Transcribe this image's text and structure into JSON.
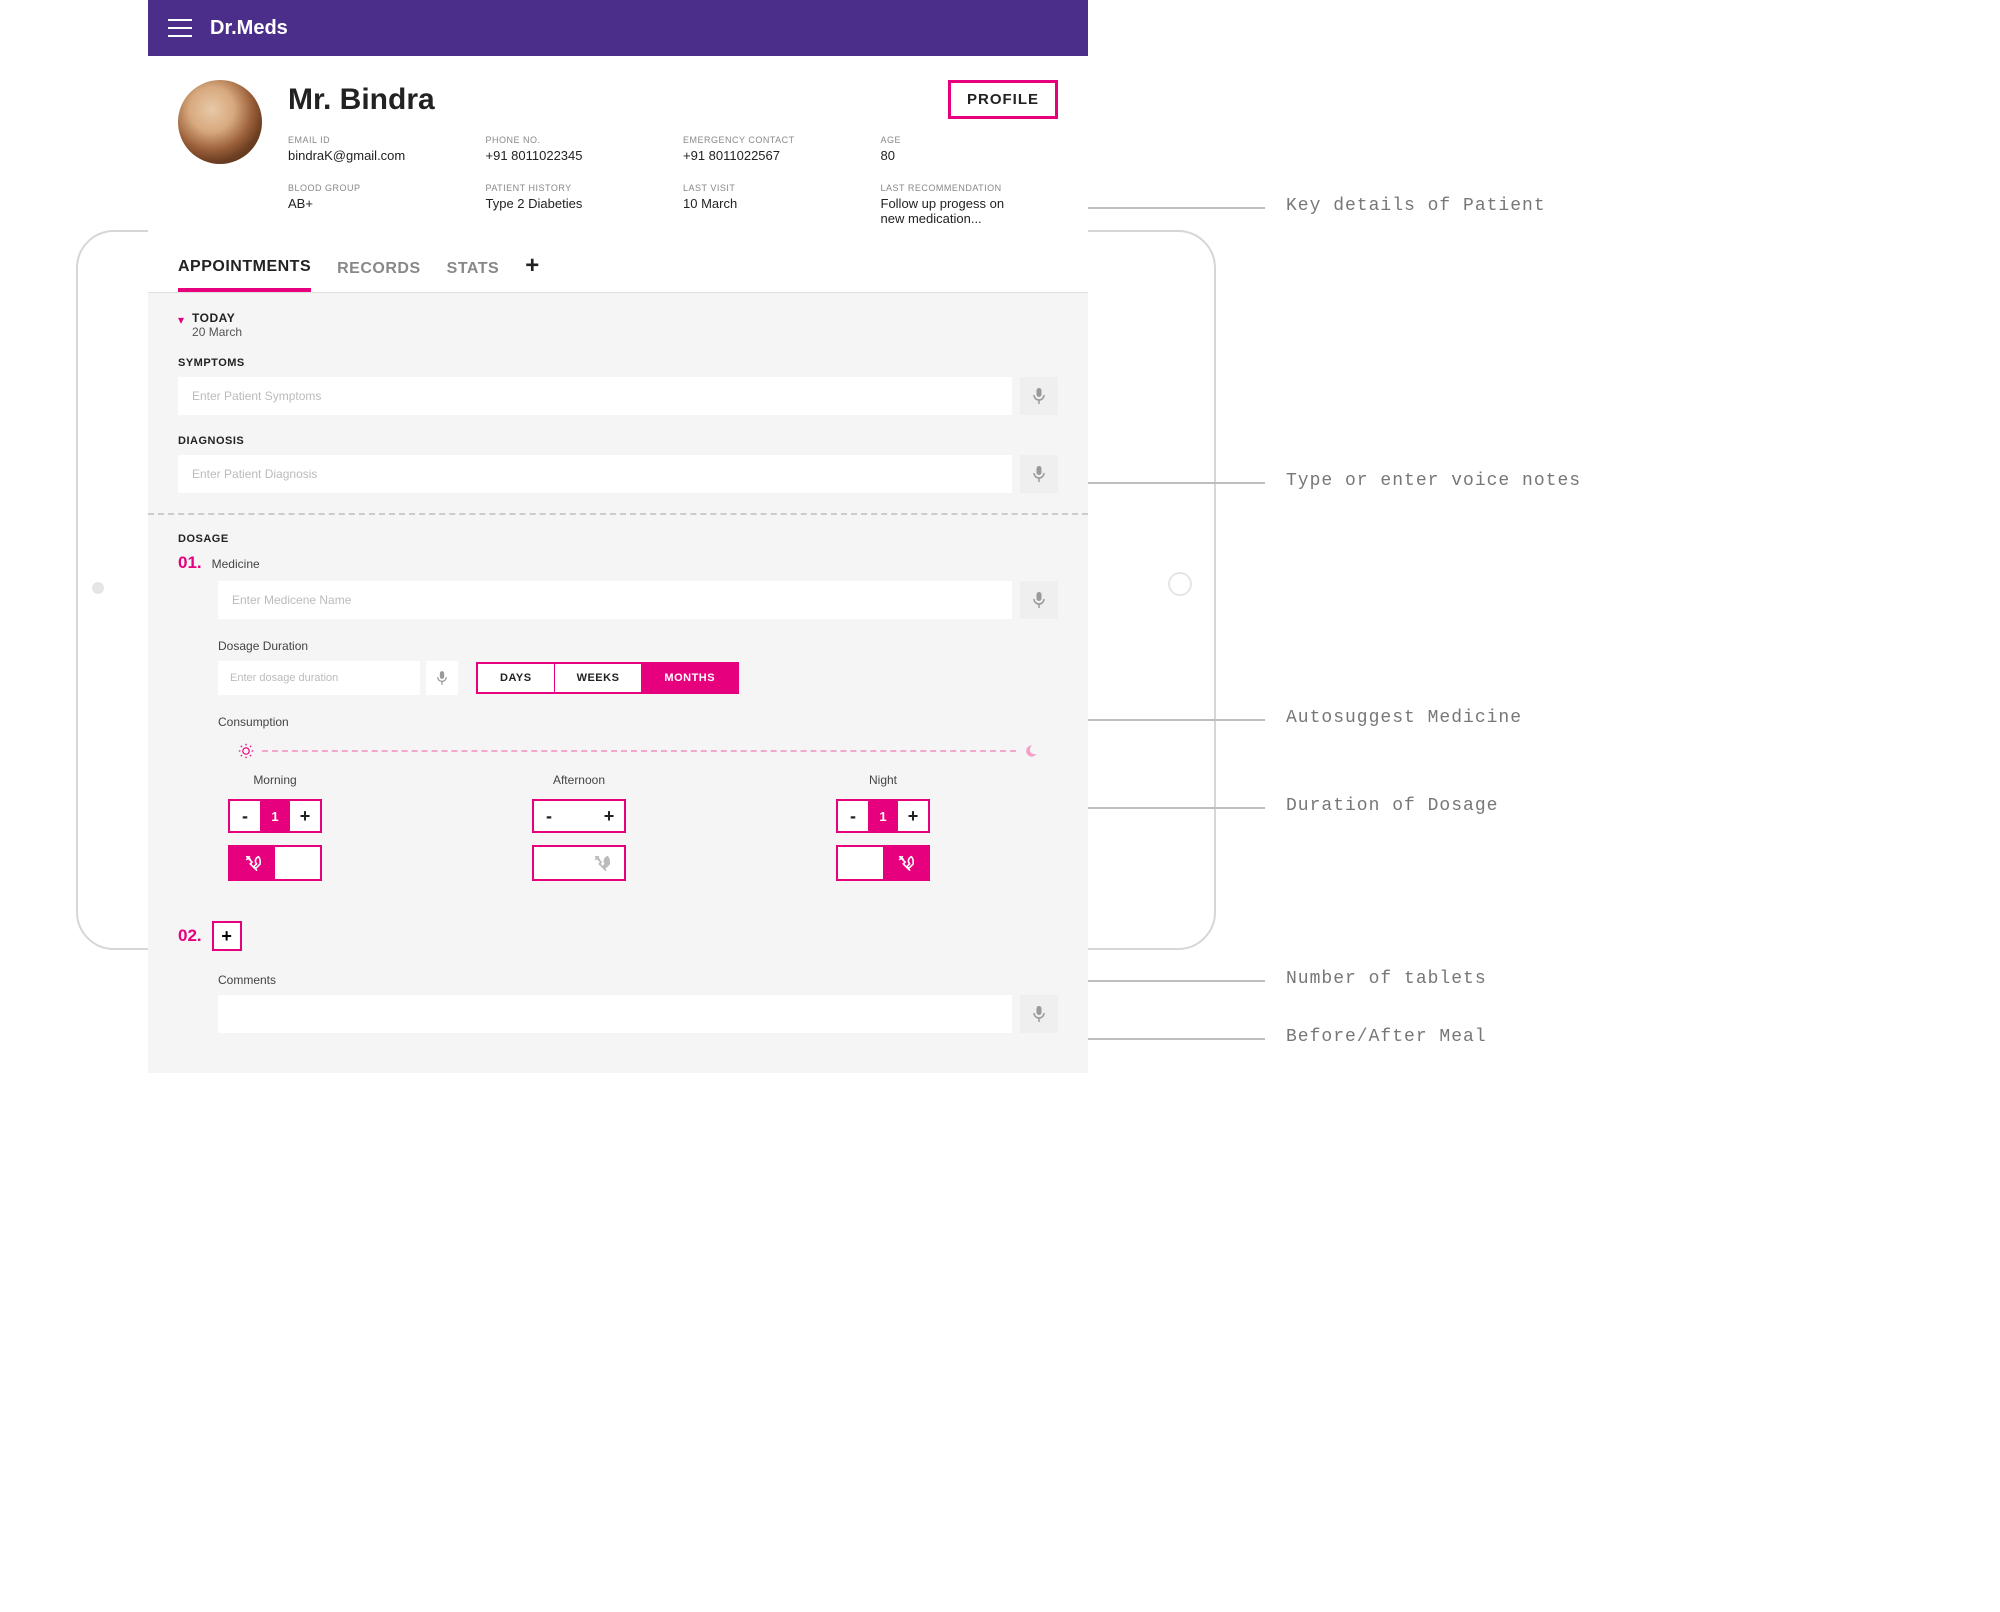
{
  "app": {
    "title": "Dr.Meds"
  },
  "patient": {
    "name": "Mr. Bindra",
    "profileButton": "PROFILE",
    "details": [
      {
        "label": "EMAIL ID",
        "value": "bindraK@gmail.com"
      },
      {
        "label": "PHONE NO.",
        "value": "+91 8011022345"
      },
      {
        "label": "EMERGENCY CONTACT",
        "value": "+91 8011022567"
      },
      {
        "label": "AGE",
        "value": "80"
      },
      {
        "label": "BLOOD GROUP",
        "value": "AB+"
      },
      {
        "label": "PATIENT HISTORY",
        "value": "Type 2 Diabeties"
      },
      {
        "label": "LAST VISIT",
        "value": "10 March"
      },
      {
        "label": "LAST RECOMMENDATION",
        "value": "Follow up progess on new medication..."
      }
    ]
  },
  "tabs": {
    "items": [
      "APPOINTMENTS",
      "RECORDS",
      "STATS"
    ],
    "activeIndex": 0
  },
  "today": {
    "label": "TODAY",
    "date": "20 March"
  },
  "sections": {
    "symptoms": {
      "label": "SYMPTOMS",
      "placeholder": "Enter Patient Symptoms"
    },
    "diagnosis": {
      "label": "DIAGNOSIS",
      "placeholder": "Enter Patient Diagnosis"
    },
    "dosage": {
      "label": "DOSAGE"
    }
  },
  "dosage": {
    "items": [
      {
        "num": "01.",
        "medicine": {
          "label": "Medicine",
          "placeholder": "Enter Medicene Name"
        },
        "duration": {
          "label": "Dosage Duration",
          "placeholder": "Enter dosage duration",
          "options": [
            "DAYS",
            "WEEKS",
            "MONTHS"
          ],
          "activeIndex": 2
        },
        "consumption": {
          "label": "Consumption",
          "periods": [
            {
              "name": "Morning",
              "count": "1",
              "filled": true,
              "mealBefore": true
            },
            {
              "name": "Afternoon",
              "count": "",
              "filled": false,
              "mealBefore": null
            },
            {
              "name": "Night",
              "count": "1",
              "filled": true,
              "mealBefore": false
            }
          ]
        }
      }
    ],
    "addNum": "02.",
    "comments": {
      "label": "Comments"
    }
  },
  "annotations": {
    "patientDetails": "Key details of Patient",
    "voiceNotes": "Type or enter voice notes",
    "autosuggest": "Autosuggest Medicine",
    "duration": "Duration of Dosage",
    "tablets": "Number of tablets",
    "meal": "Before/After Meal"
  }
}
